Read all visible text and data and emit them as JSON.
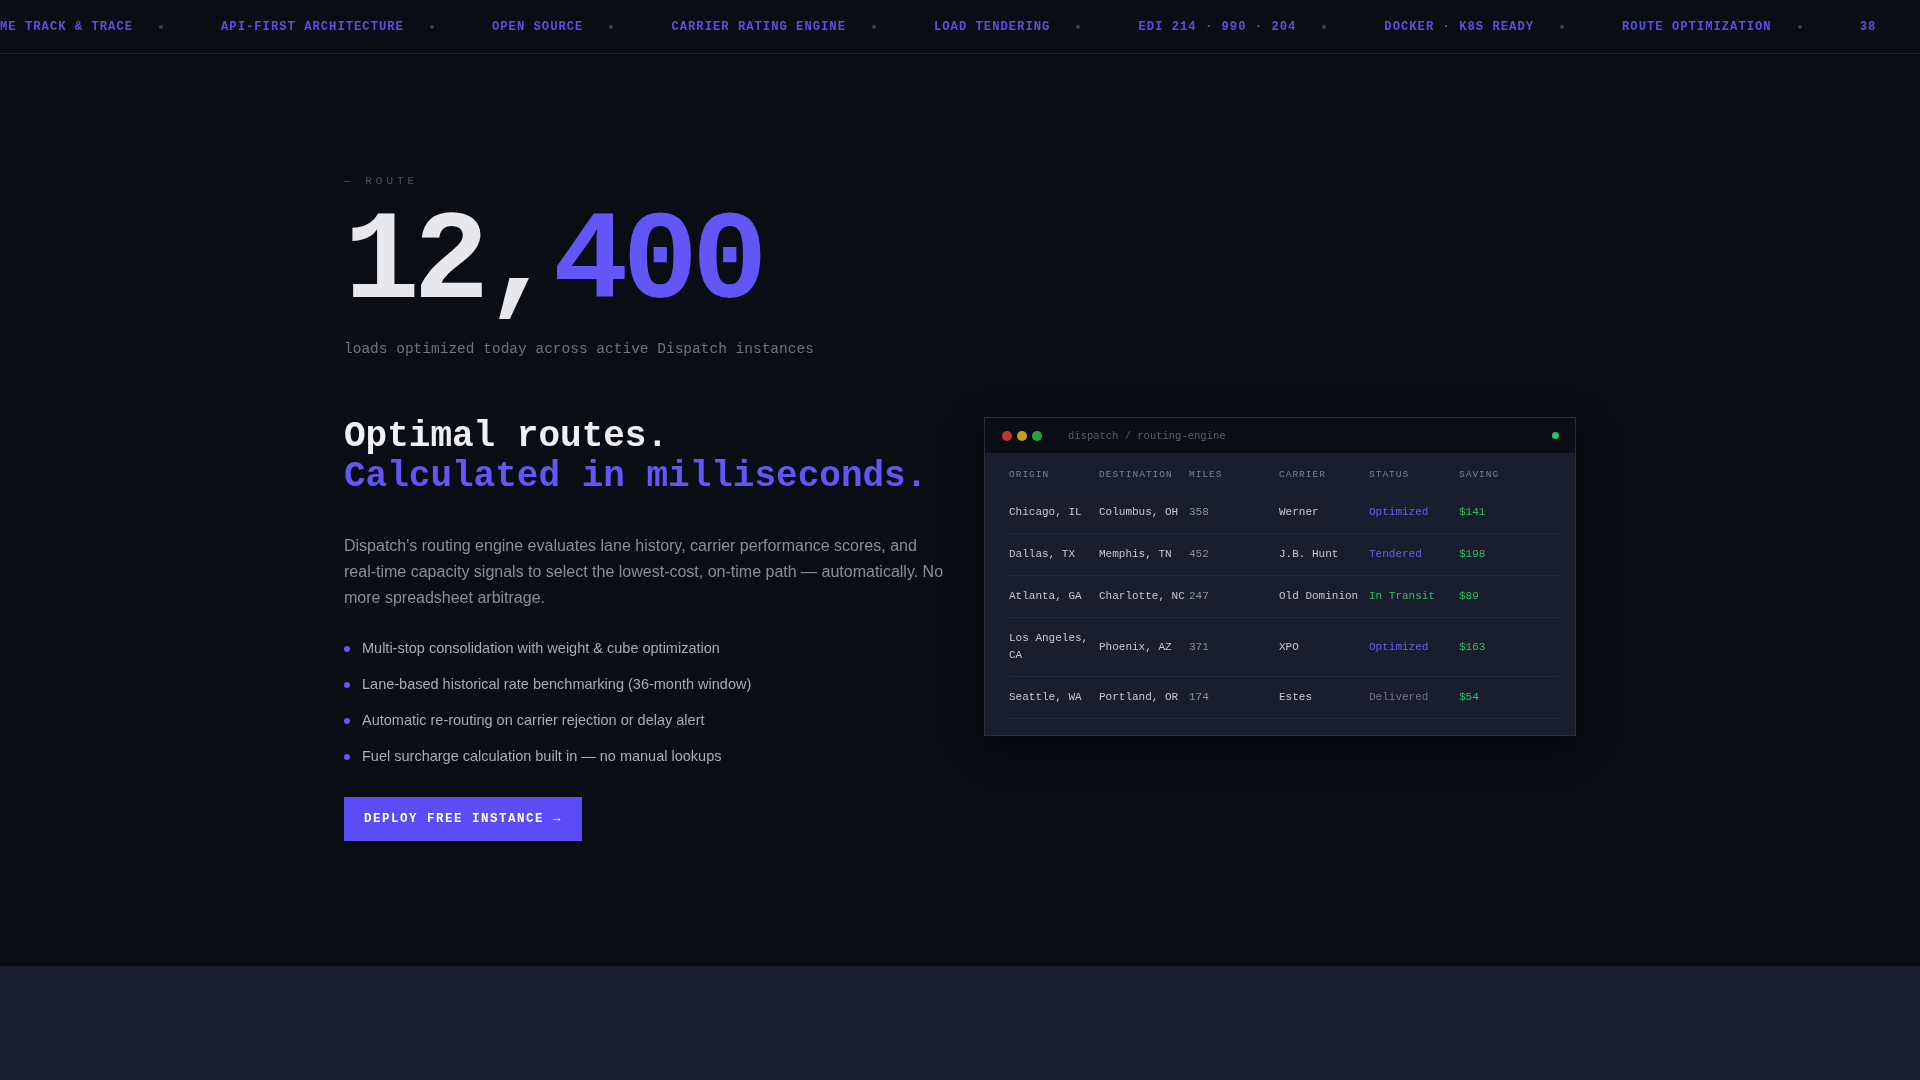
{
  "ticker": [
    "ME TRACK & TRACE",
    "API-FIRST ARCHITECTURE",
    "OPEN SOURCE",
    "CARRIER RATING ENGINE",
    "LOAD TENDERING",
    "EDI 214 · 990 · 204",
    "DOCKER · K8S READY",
    "ROUTE OPTIMIZATION",
    "38"
  ],
  "hero": {
    "eyebrow": "— ROUTE",
    "counter": {
      "lead": "12,",
      "accent": "400"
    },
    "caption": "loads optimized today across active Dispatch instances"
  },
  "feature": {
    "heading": "Optimal routes.",
    "heading_accent": "Calculated in milliseconds.",
    "body": "Dispatch's routing engine evaluates lane history, carrier performance scores, and real-time capacity signals to select the lowest-cost, on-time path — automatically. No more spreadsheet arbitrage.",
    "bullets": [
      "Multi-stop consolidation with weight & cube optimization",
      "Lane-based historical rate benchmarking (36-month window)",
      "Automatic re-routing on carrier rejection or delay alert",
      "Fuel surcharge calculation built in — no manual lookups"
    ],
    "button": "DEPLOY FREE INSTANCE →"
  },
  "window": {
    "title": "dispatch / routing-engine",
    "columns": [
      "ORIGIN",
      "DESTINATION",
      "MILES",
      "CARRIER",
      "STATUS",
      "SAVING"
    ],
    "rows": [
      {
        "origin": "Chicago, IL",
        "destination": "Columbus, OH",
        "miles": "358",
        "carrier": "Werner",
        "status": "Optimized",
        "kind": "optimized",
        "saving": "$141"
      },
      {
        "origin": "Dallas, TX",
        "destination": "Memphis, TN",
        "miles": "452",
        "carrier": "J.B. Hunt",
        "status": "Tendered",
        "kind": "tendered",
        "saving": "$198"
      },
      {
        "origin": "Atlanta, GA",
        "destination": "Charlotte, NC",
        "miles": "247",
        "carrier": "Old Dominion",
        "status": "In Transit",
        "kind": "transit",
        "saving": "$89"
      },
      {
        "origin": "Los Angeles, CA",
        "destination": "Phoenix, AZ",
        "miles": "371",
        "carrier": "XPO",
        "status": "Optimized",
        "kind": "optimized",
        "saving": "$163"
      },
      {
        "origin": "Seattle, WA",
        "destination": "Portland, OR",
        "miles": "174",
        "carrier": "Estes",
        "status": "Delivered",
        "kind": "delivered",
        "saving": "$54"
      }
    ]
  }
}
